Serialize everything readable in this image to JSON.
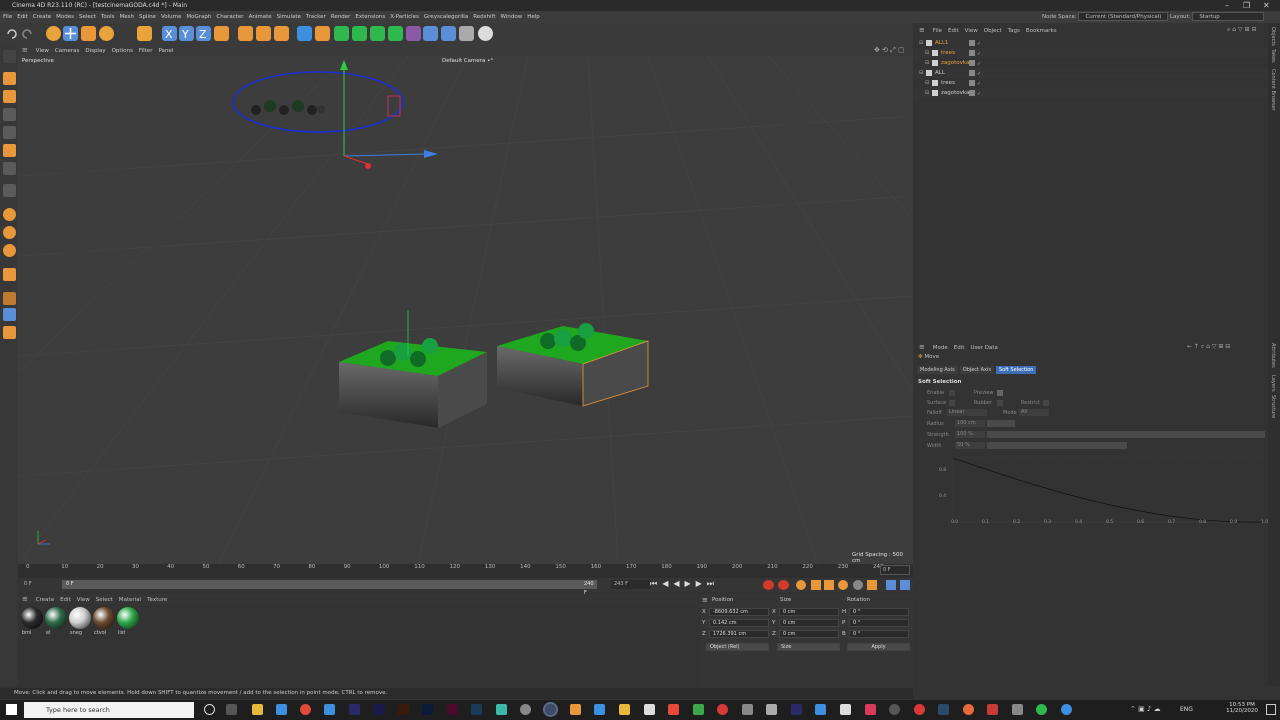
{
  "window": {
    "title": "Cinema 4D R23.110 (RC) - [testcinemaGODA.c4d *] - Main",
    "controls": [
      "–",
      "❐",
      "✕"
    ]
  },
  "menubar": {
    "items": [
      "File",
      "Edit",
      "Create",
      "Modes",
      "Select",
      "Tools",
      "Mesh",
      "Spline",
      "Volume",
      "MoGraph",
      "Character",
      "Animate",
      "Simulate",
      "Tracker",
      "Render",
      "Extensions",
      "X-Particles",
      "Greyscalegorilla",
      "Redshift",
      "Window",
      "Help"
    ],
    "node_space_label": "Node Space:",
    "node_space_value": "Current (Standard/Physical)",
    "layout_label": "Layout:",
    "layout_value": "Startup"
  },
  "viewport": {
    "menu": [
      "View",
      "Cameras",
      "Display",
      "Options",
      "Filter",
      "Panel"
    ],
    "label": "Perspective",
    "camera": "Default Camera •°",
    "grid_spacing": "Grid Spacing : 500 cm"
  },
  "timeline": {
    "ticks": [
      "0",
      "10",
      "20",
      "30",
      "40",
      "50",
      "60",
      "70",
      "80",
      "90",
      "100",
      "110",
      "120",
      "130",
      "140",
      "150",
      "160",
      "170",
      "180",
      "190",
      "200",
      "210",
      "220",
      "230",
      "240"
    ],
    "current_frame": "0 F",
    "start_frame": "0 F",
    "start_field": "0 F",
    "end_field": "240 F",
    "end_frame": "243 F"
  },
  "materials": {
    "menu": [
      "Create",
      "Edit",
      "View",
      "Select",
      "Material",
      "Texture"
    ],
    "items": [
      {
        "name": "bmi",
        "color": "#2b2b2b"
      },
      {
        "name": "el",
        "color": "#2f6b4a"
      },
      {
        "name": "sneg",
        "color": "#cfcfcf"
      },
      {
        "name": "ctvol",
        "color": "#6b4a30"
      },
      {
        "name": "list",
        "color": "#2ea84a"
      }
    ]
  },
  "coordinates": {
    "headers": [
      "Position",
      "Size",
      "Rotation"
    ],
    "rows": [
      {
        "axis": "X",
        "pos": "-8609.632 cm",
        "size_axis": "X",
        "size": "0 cm",
        "rot_axis": "H",
        "rot": "0 °"
      },
      {
        "axis": "Y",
        "pos": "0.142 cm",
        "size_axis": "Y",
        "size": "0 cm",
        "rot_axis": "P",
        "rot": "0 °"
      },
      {
        "axis": "Z",
        "pos": "1726.391 cm",
        "size_axis": "Z",
        "size": "0 cm",
        "rot_axis": "B",
        "rot": "0 °"
      }
    ],
    "mode": "Object (Rel)",
    "size_mode": "Size",
    "apply": "Apply"
  },
  "objects": {
    "menu": [
      "File",
      "Edit",
      "View",
      "Object",
      "Tags",
      "Bookmarks"
    ],
    "rows": [
      {
        "name": "ALL1",
        "color": "#e8a33a",
        "indent": 1
      },
      {
        "name": "trees",
        "color": "#e8a33a",
        "indent": 2
      },
      {
        "name": "zagotovka",
        "color": "#e8a33a",
        "indent": 2
      },
      {
        "name": "ALL",
        "color": "#cfcfcf",
        "indent": 1
      },
      {
        "name": "trees",
        "color": "#cfcfcf",
        "indent": 2
      },
      {
        "name": "zagotovka",
        "color": "#cfcfcf",
        "indent": 2
      }
    ]
  },
  "attributes": {
    "menu": [
      "Mode",
      "Edit",
      "User Data"
    ],
    "tool": "Move",
    "tabs": [
      "Modeling Axis",
      "Object Axis",
      "Soft Selection"
    ],
    "active_tab": "Soft Selection",
    "section": "Soft Selection",
    "fields": {
      "enable": "Enable",
      "preview": "Preview",
      "surface": "Surface",
      "rubber": "Rubber",
      "restrict": "Restrict",
      "falloff": "Falloff",
      "falloff_value": "Linear",
      "mode": "Mode",
      "mode_value": "All",
      "radius": "Radius",
      "radius_value": "100 cm",
      "strength": "Strength",
      "strength_value": "100 %",
      "width": "Width",
      "width_value": "50 %"
    },
    "graph_y": [
      "0.8",
      "0.4"
    ],
    "graph_x": [
      "0.0",
      "0.1",
      "0.2",
      "0.3",
      "0.4",
      "0.5",
      "0.6",
      "0.7",
      "0.8",
      "0.9",
      "1.0"
    ]
  },
  "right_tabs": [
    "Objects",
    "Takes",
    "Content Browser",
    "Attributes",
    "Layers",
    "Structure"
  ],
  "status": "Move: Click and drag to move elements. Hold down SHIFT to quantize movement / add to the selection in point mode, CTRL to remove.",
  "taskbar": {
    "search": "Type here to search",
    "lang": "ENG",
    "time": "10:53 PM",
    "date": "11/20/2020"
  }
}
